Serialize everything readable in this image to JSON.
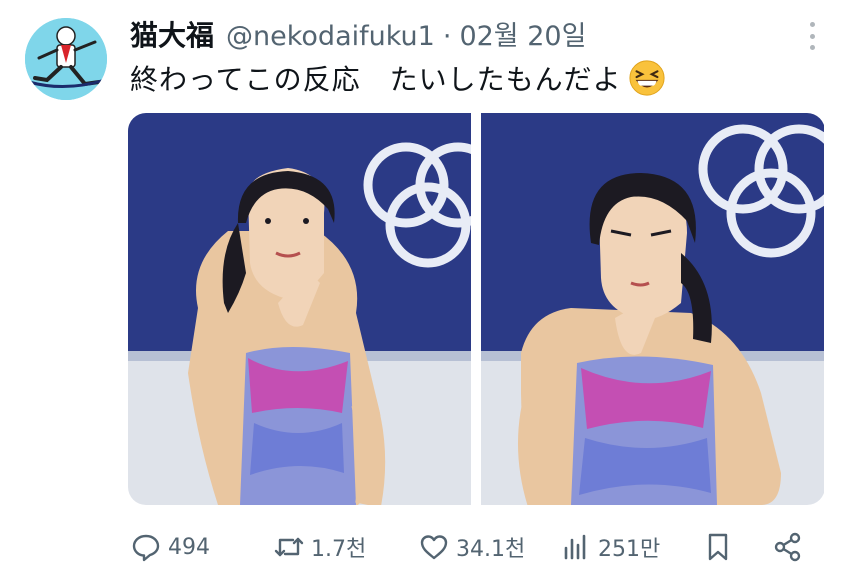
{
  "author": {
    "display_name": "猫大福",
    "handle": "@nekodaifuku1",
    "separator": "·",
    "date": "02월 20일",
    "avatar_icon": "skater-avatar-icon"
  },
  "tweet": {
    "text": "終わってこの反応　たいしたもんだよ",
    "emoji": "grinning-squinting-face-emoji"
  },
  "media": {
    "count": 2,
    "photos": [
      {
        "subject": "figure-skater-photo-left"
      },
      {
        "subject": "figure-skater-photo-right"
      }
    ]
  },
  "metrics": {
    "replies": "494",
    "retweets": "1.7천",
    "likes": "34.1천",
    "views": "251만"
  },
  "colors": {
    "text_primary": "#0f1419",
    "text_secondary": "#536471",
    "rink_backdrop": "#2b3a86",
    "avatar_bg": "#7fd6ea"
  }
}
